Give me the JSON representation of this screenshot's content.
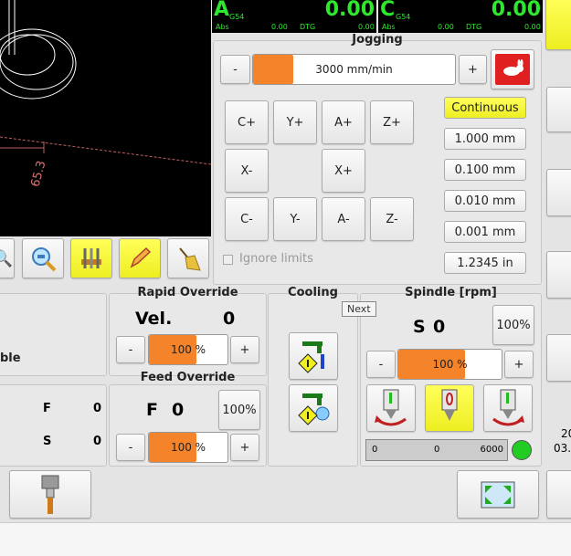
{
  "dro": [
    {
      "axis": "A",
      "wcs": "G54",
      "value": "0.00",
      "abs_label": "Abs",
      "abs": "0.00",
      "dtg_label": "DTG",
      "dtg": "0.00"
    },
    {
      "axis": "C",
      "wcs": "G54",
      "value": "0.00",
      "abs_label": "Abs",
      "abs": "0.00",
      "dtg_label": "DTG",
      "dtg": "0.00"
    }
  ],
  "viewer": {
    "dimension_label": "65.3"
  },
  "toolbar_icons": [
    "zoom-icon",
    "zoom-fit-icon",
    "tool-table-icon",
    "pencil-icon",
    "broom-icon"
  ],
  "jogging": {
    "title": "Jogging",
    "minus": "-",
    "plus": "+",
    "speed": "3000 mm/min",
    "speed_fraction": 0.2,
    "buttons": [
      "C+",
      "Y+",
      "A+",
      "Z+",
      "X-",
      "X+",
      "C-",
      "Y-",
      "A-",
      "Z-"
    ],
    "increments": [
      "Continuous",
      "1.000 mm",
      "0.100 mm",
      "0.010 mm",
      "0.001 mm",
      "1.2345 in"
    ],
    "ignore_limits": "Ignore limits"
  },
  "left_partial": {
    "label": "ble",
    "f_label": "F",
    "f_value": "0",
    "s_label": "S",
    "s_value": "0"
  },
  "rapid_override": {
    "title": "Rapid Override",
    "label": "Vel.",
    "value": "0",
    "minus": "-",
    "plus": "+",
    "percent": "100 %",
    "fraction": 0.6
  },
  "feed_override": {
    "title": "Feed Override",
    "label": "F",
    "value": "0",
    "reset": "100%",
    "minus": "-",
    "plus": "+",
    "percent": "100 %",
    "fraction": 0.6
  },
  "cooling": {
    "title": "Cooling",
    "tooltip": "Next"
  },
  "spindle": {
    "title": "Spindle [rpm]",
    "label": "S",
    "value": "0",
    "reset": "100%",
    "minus": "-",
    "plus": "+",
    "percent": "100 %",
    "fraction": 0.65,
    "bar_min": "0",
    "bar_mid": "0",
    "bar_max": "6000",
    "status_color": "#22cc22"
  },
  "right_partial": {
    "line1": "20",
    "line2": "03."
  },
  "colors": {
    "accent": "#f5832a",
    "active": "#f4f430",
    "dro_green": "#2ee82e"
  }
}
